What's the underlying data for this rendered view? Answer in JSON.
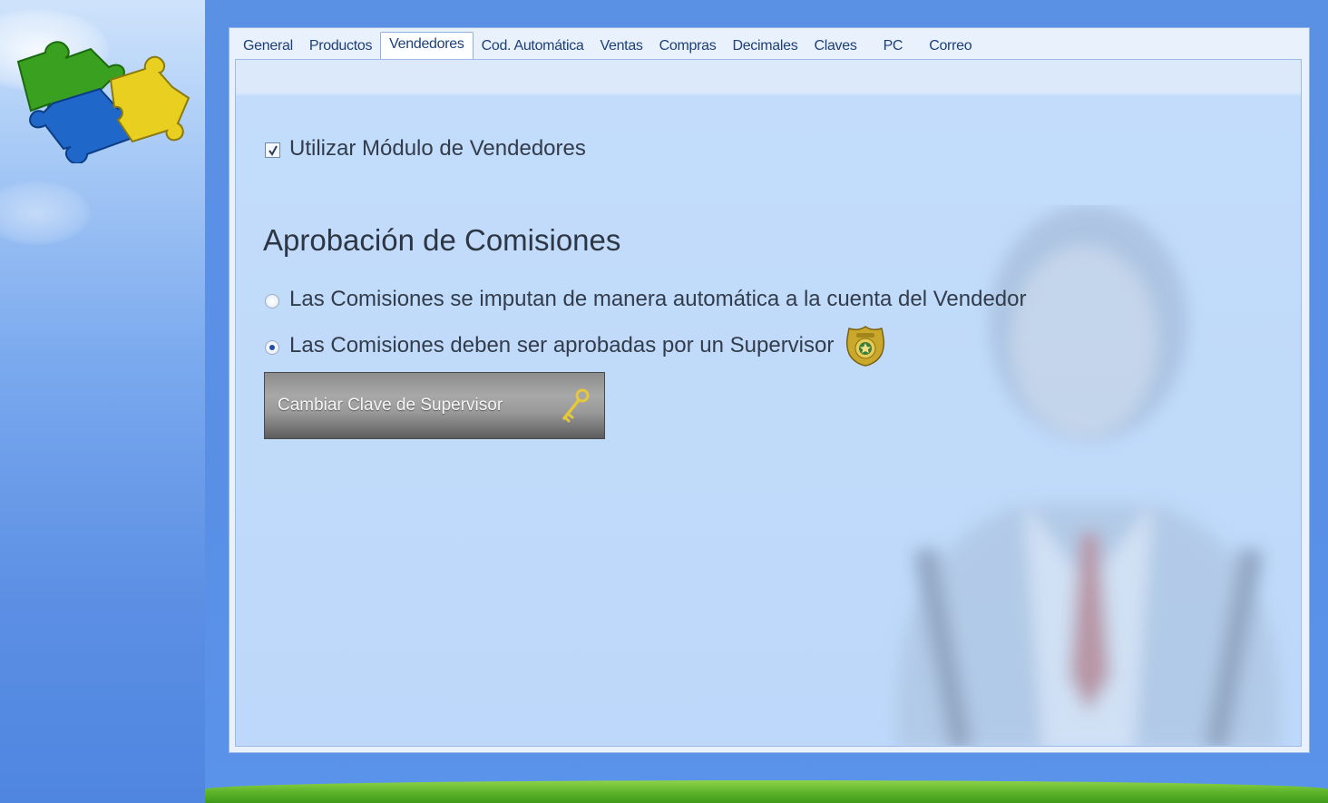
{
  "tabs": [
    {
      "label": "General",
      "active": false
    },
    {
      "label": "Productos",
      "active": false
    },
    {
      "label": "Vendedores",
      "active": true
    },
    {
      "label": "Cod. Automática",
      "active": false
    },
    {
      "label": "Ventas",
      "active": false
    },
    {
      "label": "Compras",
      "active": false
    },
    {
      "label": "Decimales",
      "active": false
    },
    {
      "label": "Claves",
      "active": false
    },
    {
      "label": "PC",
      "active": false
    },
    {
      "label": "Correo",
      "active": false
    }
  ],
  "vendedores": {
    "use_module": {
      "label": "Utilizar Módulo de Vendedores",
      "checked": true
    },
    "section_title": "Aprobación de Comisiones",
    "options": [
      {
        "label": "Las Comisiones se imputan de manera automática a la cuenta del Vendedor",
        "selected": false
      },
      {
        "label": "Las Comisiones deben ser aprobadas por un Supervisor",
        "selected": true
      }
    ],
    "change_key_button": "Cambiar Clave de Supervisor"
  },
  "icons": {
    "logo": "puzzle-pieces-icon",
    "supervisor": "police-badge-icon",
    "key": "key-icon",
    "watermark": "salesman-silhouette-icon"
  },
  "colors": {
    "tab_text": "#1d3f7a",
    "content_bg": "#bdd8fa",
    "button_bg": "#9a9a9a"
  }
}
